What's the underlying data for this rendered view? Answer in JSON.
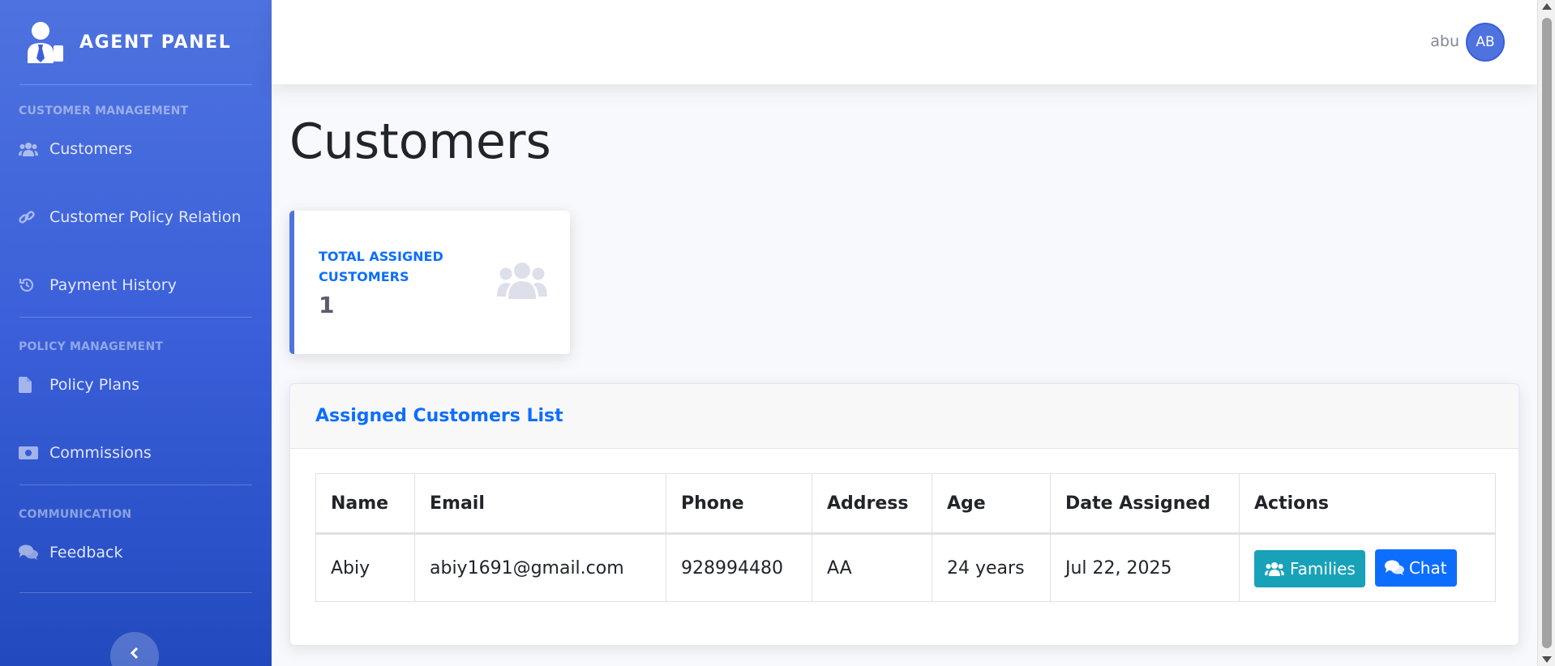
{
  "brand": {
    "title": "AGENT PANEL"
  },
  "sidebar": {
    "sections": [
      {
        "heading": "CUSTOMER MANAGEMENT",
        "items": [
          {
            "label": "Customers",
            "icon": "users-icon"
          },
          {
            "label": "Customer Policy Relation",
            "icon": "link-icon"
          },
          {
            "label": "Payment History",
            "icon": "history-icon"
          }
        ]
      },
      {
        "heading": "POLICY MANAGEMENT",
        "items": [
          {
            "label": "Policy Plans",
            "icon": "file-icon"
          },
          {
            "label": "Commissions",
            "icon": "money-icon"
          }
        ]
      },
      {
        "heading": "COMMUNICATION",
        "items": [
          {
            "label": "Feedback",
            "icon": "comments-icon"
          }
        ]
      }
    ]
  },
  "topbar": {
    "user_name": "abu",
    "avatar_initials": "AB"
  },
  "page": {
    "title": "Customers"
  },
  "stat_card": {
    "label": "TOTAL ASSIGNED CUSTOMERS",
    "value": "1"
  },
  "customers_card": {
    "title": "Assigned Customers List",
    "columns": [
      "Name",
      "Email",
      "Phone",
      "Address",
      "Age",
      "Date Assigned",
      "Actions"
    ],
    "rows": [
      {
        "name": "Abiy",
        "email": "abiy1691@gmail.com",
        "phone": "928994480",
        "address": "AA",
        "age": "24 years",
        "date_assigned": "Jul 22, 2025",
        "actions": {
          "families": "Families",
          "chat": "Chat"
        }
      }
    ]
  },
  "colors": {
    "primary": "#4e73df",
    "info": "#17a2b8",
    "blue": "#0d6efd"
  }
}
